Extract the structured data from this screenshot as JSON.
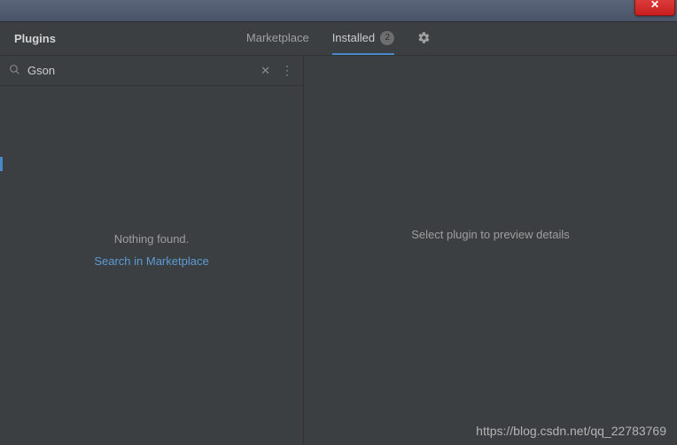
{
  "titlebar": {
    "close_symbol": "✕"
  },
  "header": {
    "title": "Plugins",
    "tabs": {
      "marketplace": "Marketplace",
      "installed": "Installed",
      "installed_badge": "2"
    }
  },
  "search": {
    "value": "Gson",
    "placeholder": ""
  },
  "left": {
    "nothing": "Nothing found.",
    "search_link": "Search in Marketplace"
  },
  "right": {
    "preview": "Select plugin to preview details"
  },
  "watermark": "https://blog.csdn.net/qq_22783769"
}
